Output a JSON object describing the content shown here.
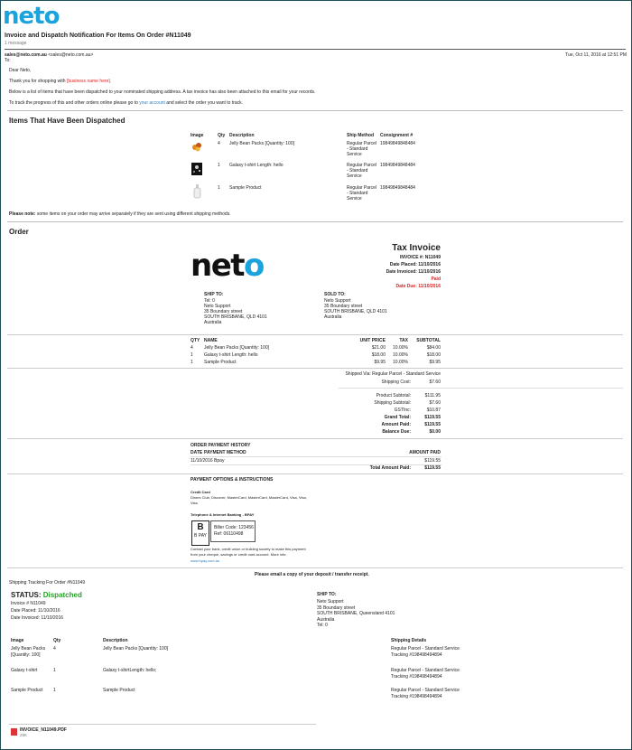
{
  "brand": {
    "logo_text": "neto",
    "accent": "#1aa3dc"
  },
  "email": {
    "subject": "Invoice and Dispatch Notification For Items On Order #N11049",
    "message_count": "1 message",
    "from_label": "sales@neto.com.au",
    "from_addr": "<sales@neto.com.au>",
    "to_label": "To:",
    "date": "Tue, Oct 11, 2016 at 12:51 PM",
    "greeting": "Dear Neto,",
    "thanks_prefix": "Thank you for shopping with ",
    "business_name": "[business name here].",
    "intro": "Below is a list of items that have been dispatched to your nominated shipping address. A tax invoice has also been attached to this email for your records.",
    "track_prefix": "To track the progress of this and other orders online please go to ",
    "your_account": "your account",
    "track_suffix": " and select the order you want to track.",
    "dispatched_heading": "Items That Have Been Dispatched",
    "note_bold": "Please note:",
    "note_text": " some items on your order may arrive separately if they are sent using different shipping methods.",
    "order_heading": "Order"
  },
  "dispatch_table": {
    "headers": [
      "Image",
      "Qty",
      "Description",
      "Ship Method",
      "Consignment #"
    ],
    "rows": [
      {
        "qty": "4",
        "desc": "Jelly Bean Packs [Quantity: 100]",
        "method1": "Regular Parcel",
        "method2": "- Standard",
        "method3": "Service",
        "consignment": "19849849848484"
      },
      {
        "qty": "1",
        "desc": "Galaxy t-shirt Length: hello",
        "method1": "Regular Parcel",
        "method2": "- Standard",
        "method3": "Service",
        "consignment": "19849849848484"
      },
      {
        "qty": "1",
        "desc": "Sample Product",
        "method1": "Regular Parcel",
        "method2": "- Standard",
        "method3": "Service",
        "consignment": "19849849848484"
      }
    ]
  },
  "invoice": {
    "title": "Tax Invoice",
    "invoice_no": "INVOICE #: N11049",
    "date_placed": "Date Placed: 11/10/2016",
    "date_invoiced": "Date Invoiced: 11/10/2016",
    "paid": "Paid",
    "date_due": "Date Due: 11/10/2016",
    "ship_to_label": "SHIP TO:",
    "ship_to": [
      "Tel: 0",
      "Neto Support",
      "35 Boundary street",
      "SOUTH BRISBANE, QLD 4101",
      "Australia"
    ],
    "sold_to_label": "SOLD TO:",
    "sold_to": [
      "Neto Support",
      "35 Boundary street",
      "SOUTH BRISBANE, QLD 4101",
      "Australia"
    ],
    "items_headers": [
      "QTY",
      "NAME",
      "UNIT PRICE",
      "TAX",
      "SUBTOTAL"
    ],
    "items": [
      {
        "qty": "4",
        "name": "Jelly Bean Packs [Quantity: 100]",
        "unit": "$21.00",
        "tax": "10.00%",
        "subtotal": "$84.00"
      },
      {
        "qty": "1",
        "name": "Galaxy t-shirt Length: hello",
        "unit": "$18.00",
        "tax": "10.00%",
        "subtotal": "$18.00"
      },
      {
        "qty": "1",
        "name": "Sample Product",
        "unit": "$9.95",
        "tax": "10.00%",
        "subtotal": "$9.95"
      }
    ],
    "shipped_via": "Shipped Via: Regular Parcel - Standard Service",
    "shipping_cost_label": "Shipping Cost:",
    "shipping_cost": "$7.60",
    "product_subtotal_label": "Product Subtotal:",
    "product_subtotal": "$111.95",
    "shipping_subtotal_label": "Shipping Subtotal:",
    "shipping_subtotal": "$7.60",
    "gst_label": "GSTInc:",
    "gst": "$10.87",
    "grand_total_label": "Grand Total:",
    "grand_total": "$119.55",
    "amount_paid_label": "Amount Paid:",
    "amount_paid": "$119.55",
    "balance_due_label": "Balance Due:",
    "balance_due": "$0.00",
    "payment_history_label": "ORDER PAYMENT HISTORY",
    "ph_date": "DATE",
    "ph_method": "PAYMENT METHOD",
    "ph_amount": "AMOUNT PAID",
    "ph_row_date": "11/10/2016 Bpay",
    "ph_row_amount": "$119.55",
    "total_amount_paid_label": "Total Amount Paid:",
    "total_amount_paid": "$119.55",
    "payment_options_label": "PAYMENT OPTIONS & INSTRUCTIONS",
    "credit_card_label": "Credit Card",
    "credit_card_text1": "Diners Club, Discover, MasterCard, MasterCard, MasterCard, Visa, Visa,",
    "credit_card_text2": "Visa",
    "bpay_label": "Telephone & Internet Banking - BPAY",
    "bpay_logo": "B PAY",
    "biller_code": "Biller Code: 123456",
    "bpay_ref": "Ref: 06110498",
    "bpay_instr1": "Contact your bank, credit union or building society to make this payment",
    "bpay_instr2": "from your cheque, savings or credit card account. More info:",
    "bpay_link": "www.bpay.com.au",
    "email_receipt": "Please email a copy of your deposit / transfer receipt."
  },
  "tracking": {
    "label": "Shipping Tracking For Order #N11049",
    "status_label": "STATUS:",
    "status_value": "Dispatched",
    "status_color": "#2aa02a",
    "invoice": "Invoice # N11049",
    "placed": "Date Placed: 11/10/2016",
    "invoiced": "Date Invoiced: 11/10/2016",
    "ship_to_label": "SHIP TO:",
    "ship_to": [
      "Neto Support",
      "35 Boundary street",
      "SOUTH BRISBANE, Queensland 4101",
      "Australia",
      "Tel: 0"
    ],
    "headers": [
      "Image",
      "Qty",
      "Description",
      "Shipping Details"
    ],
    "rows": [
      {
        "image1": "Jelly Bean Packs",
        "image2": "[Quantity: 100]",
        "qty": "4",
        "desc": "Jelly Bean Packs [Quantity: 100]",
        "ship1": "Regular Parcel - Standard Service",
        "ship2": "Tracking #198498494894"
      },
      {
        "image1": "Galaxy t-shirt",
        "image2": "",
        "qty": "1",
        "desc": "Galaxy t-shirtLength: hello;",
        "ship1": "Regular Parcel - Standard Service",
        "ship2": "Tracking #198498494894"
      },
      {
        "image1": "Sample Product",
        "image2": "",
        "qty": "1",
        "desc": "Sample Product",
        "ship1": "Regular Parcel - Standard Service",
        "ship2": "Tracking #198498494894"
      }
    ]
  },
  "attachment": {
    "name": "INVOICE_N11049.PDF",
    "size": "29K"
  }
}
